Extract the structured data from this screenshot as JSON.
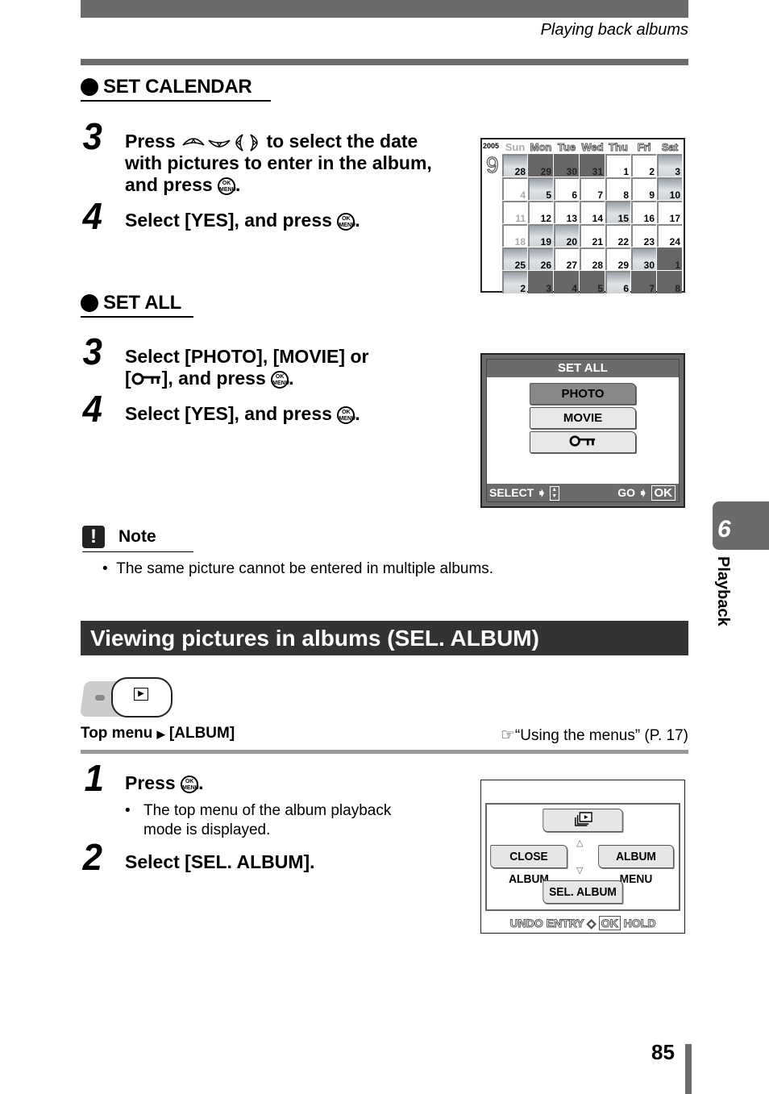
{
  "header": {
    "running_head": "Playing back albums"
  },
  "set_calendar": {
    "title": "SET CALENDAR",
    "step3": {
      "num": "3",
      "text_a": "Press",
      "text_b": "to select the date with pictures to enter in the album, and press",
      "end": "."
    },
    "step4": {
      "num": "4",
      "text": "Select [YES], and press",
      "end": "."
    },
    "screen": {
      "year": "2005",
      "month": "9",
      "weekdays": [
        "Sun",
        "Mon",
        "Tue",
        "Wed",
        "Thu",
        "Fri",
        "Sat"
      ],
      "weeks": [
        [
          {
            "d": "28",
            "t": "photo"
          },
          {
            "d": "29",
            "t": "dark"
          },
          {
            "d": "30",
            "t": "dark"
          },
          {
            "d": "31",
            "t": "dark"
          },
          {
            "d": "1",
            "t": ""
          },
          {
            "d": "2",
            "t": ""
          },
          {
            "d": "3",
            "t": "photo"
          }
        ],
        [
          {
            "d": "4",
            "t": "sun"
          },
          {
            "d": "5",
            "t": "photo"
          },
          {
            "d": "6",
            "t": ""
          },
          {
            "d": "7",
            "t": ""
          },
          {
            "d": "8",
            "t": ""
          },
          {
            "d": "9",
            "t": ""
          },
          {
            "d": "10",
            "t": "photo"
          }
        ],
        [
          {
            "d": "11",
            "t": "sun"
          },
          {
            "d": "12",
            "t": ""
          },
          {
            "d": "13",
            "t": ""
          },
          {
            "d": "14",
            "t": ""
          },
          {
            "d": "15",
            "t": "photo"
          },
          {
            "d": "16",
            "t": ""
          },
          {
            "d": "17",
            "t": ""
          }
        ],
        [
          {
            "d": "18",
            "t": "sun"
          },
          {
            "d": "19",
            "t": "photo"
          },
          {
            "d": "20",
            "t": "photo"
          },
          {
            "d": "21",
            "t": ""
          },
          {
            "d": "22",
            "t": ""
          },
          {
            "d": "23",
            "t": ""
          },
          {
            "d": "24",
            "t": ""
          }
        ],
        [
          {
            "d": "25",
            "t": "photo"
          },
          {
            "d": "26",
            "t": "photo"
          },
          {
            "d": "27",
            "t": ""
          },
          {
            "d": "28",
            "t": ""
          },
          {
            "d": "29",
            "t": ""
          },
          {
            "d": "30",
            "t": "photo"
          },
          {
            "d": "1",
            "t": "dark"
          }
        ],
        [
          {
            "d": "2",
            "t": "photo"
          },
          {
            "d": "3",
            "t": "dark"
          },
          {
            "d": "4",
            "t": "dark"
          },
          {
            "d": "5",
            "t": "dark"
          },
          {
            "d": "6",
            "t": "photo"
          },
          {
            "d": "7",
            "t": "dark"
          },
          {
            "d": "8",
            "t": "dark"
          }
        ]
      ]
    }
  },
  "set_all": {
    "title": "SET ALL",
    "step3": {
      "num": "3",
      "text_a": "Select [PHOTO], [MOVIE] or",
      "text_b_pre": "[",
      "text_b_post": "], and press",
      "end": "."
    },
    "step4": {
      "num": "4",
      "text": "Select [YES], and press",
      "end": "."
    },
    "screen": {
      "title": "SET ALL",
      "options": [
        "PHOTO",
        "MOVIE"
      ],
      "selected": "PHOTO",
      "foot_left": "SELECT",
      "foot_right": "GO",
      "ok": "OK"
    }
  },
  "note": {
    "icon": "!",
    "title": "Note",
    "items": [
      "The same picture cannot be entered in multiple albums."
    ]
  },
  "section": {
    "title": "Viewing pictures in albums (SEL. ALBUM)",
    "menu_path_a": "Top menu",
    "menu_path_b": "[ALBUM]",
    "reference": "“Using the menus” (P. 17)",
    "step1": {
      "num": "1",
      "text": "Press",
      "end": ".",
      "bullet": "The top menu of the album playback mode is displayed."
    },
    "step2": {
      "num": "2",
      "text": "Select [SEL. ALBUM]."
    },
    "screen": {
      "left": "CLOSE ALBUM",
      "right": "ALBUM MENU",
      "bottom": "SEL. ALBUM",
      "foot_a": "UNDO ENTRY",
      "foot_ok": "OK",
      "foot_b": "HOLD"
    }
  },
  "ok_button": {
    "top": "OK",
    "bottom": "MENU"
  },
  "side_tab": {
    "number": "6",
    "label": "Playback"
  },
  "page_number": "85"
}
